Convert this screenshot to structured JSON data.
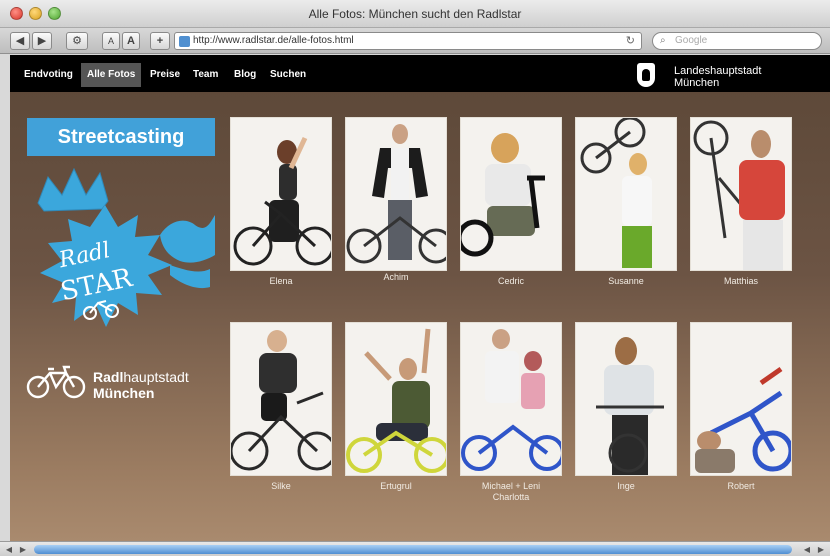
{
  "window": {
    "title": "Alle Fotos: München sucht den Radlstar"
  },
  "toolbar": {
    "back_label": "◀",
    "forward_label": "▶",
    "settings_label": "⚙",
    "text_small_label": "A",
    "text_large_label": "A",
    "add_label": "+",
    "url": "http://www.radlstar.de/alle-fotos.html",
    "search_placeholder": "Google"
  },
  "nav": {
    "items": [
      {
        "label": "Endvoting"
      },
      {
        "label": "Alle Fotos"
      },
      {
        "label": "Preise"
      },
      {
        "label": "Team"
      },
      {
        "label": "Blog"
      },
      {
        "label": "Suchen"
      }
    ],
    "active": "Alle Fotos",
    "city_line1": "Landeshauptstadt",
    "city_line2": "München"
  },
  "sidebar": {
    "streetcasting": "Streetcasting",
    "logo_line1": "Radl",
    "logo_line2": "STAR",
    "brand_bold": "Radl",
    "brand_light": "hauptstadt",
    "brand_line2": "München"
  },
  "photos": [
    {
      "caption": "Elena",
      "accent": "#2d2d2d"
    },
    {
      "caption": "Achim",
      "accent": "#1c1c1c"
    },
    {
      "caption": "Cedric",
      "accent": "#e9e9e9"
    },
    {
      "caption": "Susanne",
      "accent": "#6aa92b"
    },
    {
      "caption": "Matthias",
      "accent": "#d6463b"
    },
    {
      "caption": "Silke",
      "accent": "#2f2f2f"
    },
    {
      "caption": "Ertugrul",
      "accent": "#4c5a34"
    },
    {
      "caption": "Michael + Leni",
      "caption2": "Charlotta",
      "accent": "#e6a1b3"
    },
    {
      "caption": "Inge",
      "accent": "#dfe3e6"
    },
    {
      "caption": "Robert",
      "accent": "#2f55c9"
    }
  ],
  "colors": {
    "streetcasting_bg": "#41a1d9",
    "logo_blue": "#3ba7dc",
    "nav_bg": "#000000",
    "nav_active_bg": "#555555"
  }
}
